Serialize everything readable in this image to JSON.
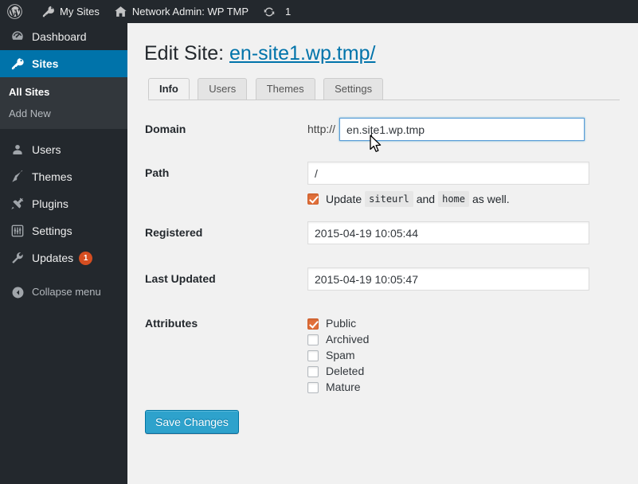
{
  "adminbar": {
    "items": [
      {
        "id": "wp-logo",
        "icon": "wordpress-icon",
        "label": ""
      },
      {
        "id": "my-sites",
        "icon": "key-icon",
        "label": "My Sites"
      },
      {
        "id": "network-admin",
        "icon": "home-icon",
        "label": "Network Admin: WP TMP"
      },
      {
        "id": "updates",
        "icon": "update-icon",
        "label": "1"
      }
    ]
  },
  "sidebar": {
    "items": [
      {
        "label": "Dashboard",
        "icon": "dashboard-icon",
        "current": false
      },
      {
        "label": "Sites",
        "icon": "key-icon",
        "current": true
      },
      {
        "label": "Users",
        "icon": "user-icon",
        "current": false
      },
      {
        "label": "Themes",
        "icon": "brush-icon",
        "current": false
      },
      {
        "label": "Plugins",
        "icon": "plugin-icon",
        "current": false
      },
      {
        "label": "Settings",
        "icon": "settings-icon",
        "current": false
      },
      {
        "label": "Updates",
        "icon": "wrench-icon",
        "current": false,
        "badge": "1"
      }
    ],
    "submenu": [
      {
        "label": "All Sites",
        "current": true
      },
      {
        "label": "Add New",
        "current": false
      }
    ],
    "collapse": {
      "label": "Collapse menu",
      "icon": "collapse-arrow-icon"
    }
  },
  "page": {
    "title_prefix": "Edit Site:",
    "site_link": "en-site1.wp.tmp/"
  },
  "tabs": [
    {
      "label": "Info",
      "active": true
    },
    {
      "label": "Users",
      "active": false
    },
    {
      "label": "Themes",
      "active": false
    },
    {
      "label": "Settings",
      "active": false
    }
  ],
  "form": {
    "domain": {
      "label": "Domain",
      "prefix": "http://",
      "value": "en.site1.wp.tmp",
      "focused": true
    },
    "path": {
      "label": "Path",
      "value": "/"
    },
    "update_hint": {
      "checked": true,
      "text_before": "Update",
      "code1": "siteurl",
      "text_middle": "and",
      "code2": "home",
      "text_after": "as well."
    },
    "registered": {
      "label": "Registered",
      "value": "2015-04-19 10:05:44"
    },
    "last_updated": {
      "label": "Last Updated",
      "value": "2015-04-19 10:05:47"
    },
    "attributes": {
      "label": "Attributes",
      "options": [
        {
          "label": "Public",
          "checked": true
        },
        {
          "label": "Archived",
          "checked": false
        },
        {
          "label": "Spam",
          "checked": false
        },
        {
          "label": "Deleted",
          "checked": false
        },
        {
          "label": "Mature",
          "checked": false
        }
      ]
    },
    "save_button": "Save Changes"
  },
  "colors": {
    "adminbar_bg": "#23282d",
    "sidebar_bg": "#23282d",
    "submenu_bg": "#32373c",
    "current_menu": "#0073aa",
    "content_bg": "#f1f1f1",
    "link": "#0073aa",
    "badge": "#d54e21",
    "checkbox_checked": "#e2703a",
    "primary_button": "#2ea2cc",
    "focus_border": "#5b9dd9"
  }
}
